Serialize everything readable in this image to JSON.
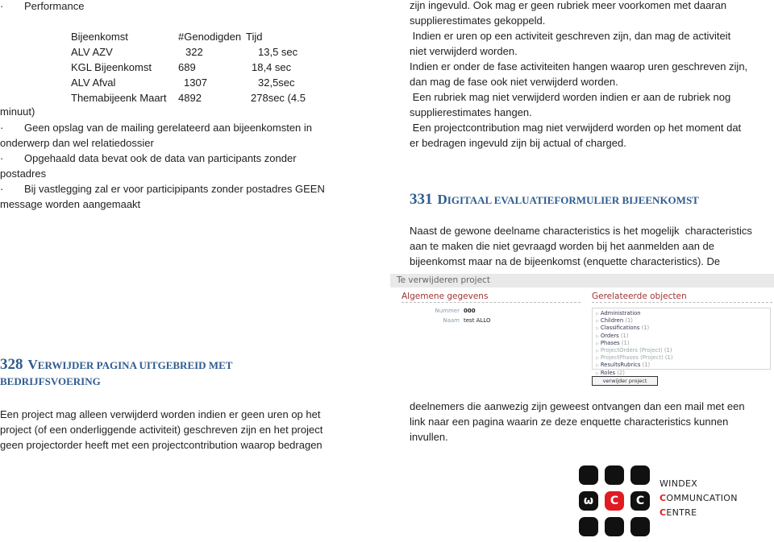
{
  "left_column": {
    "performance_bullet": "·",
    "performance_title": "Performance",
    "table": {
      "headers": [
        "Bijeenkomst",
        "#Genodigden",
        "Tijd"
      ],
      "rows": [
        [
          "ALV AZV",
          "322",
          "13,5 sec"
        ],
        [
          "KGL Bijeenkomst",
          "689",
          "18,4 sec"
        ],
        [
          "ALV Afval",
          "1307",
          "32,5sec"
        ],
        [
          "Themabijeenk Maart",
          "4892",
          "278sec (4.5"
        ]
      ],
      "overflow": "minuut)"
    },
    "bullets": [
      {
        "line1": "Geen opslag van de mailing gerelateerd aan bijeenkomsten in",
        "line2": "onderwerp dan wel relatiedossier"
      },
      {
        "line1": "Opgehaald data bevat ook de data van participants zonder",
        "line2": "postadres"
      },
      {
        "line1": "Bij vastlegging zal er voor participipants zonder postadres GEEN",
        "line2": "message worden aangemaakt"
      }
    ],
    "section328": {
      "number": "328",
      "title_first": "V",
      "title_rest": "ERWIJDER PAGINA UITGEBREID MET",
      "title_line2": "BEDRIJFSVOERING",
      "lines": [
        "Een project mag alleen verwijderd worden indien er geen uren op het",
        "project (of een onderliggende activiteit) geschreven zijn en het project",
        "geen projectorder heeft met een projectcontribution waarop bedragen"
      ]
    }
  },
  "right_column": {
    "lines_top": [
      "zijn ingevuld. Ook mag er geen rubriek meer voorkomen met daaran",
      "supplierestimates gekoppeld.",
      " Indien er uren op een activiteit geschreven zijn, dan mag de activiteit",
      "niet verwijderd worden.",
      "Indien er onder de fase activiteiten hangen waarop uren geschreven zijn,",
      "dan mag de fase ook niet verwijderd worden.",
      " Een rubriek mag niet verwijderd worden indien er aan de rubriek nog",
      "supplierestimates hangen.",
      " Een projectcontribution mag niet verwijderd worden op het moment dat",
      "er bedragen ingevuld zijn bij actual of charged."
    ],
    "section331": {
      "number": "331",
      "title_first": "D",
      "title_rest": "IGITAAL EVALUATIEFORMULIER BIJEENKOMST",
      "lines": [
        "Naast de gewone deelname characteristics is het mogelijk  characteristics",
        "aan te maken die niet gevraagd worden bij het aanmelden aan de",
        "bijeenkomst maar na de bijeenkomst (enquette characteristics). De"
      ]
    },
    "lines_bottom": [
      "deelnemers die aanwezig zijn geweest ontvangen dan een mail met een",
      "link naar een pagina waarin ze deze enquette characteristics kunnen",
      "invullen."
    ]
  },
  "screenshot": {
    "header": "Te verwijderen project",
    "general_title": "Algemene gegevens",
    "fields": [
      {
        "label": "Nummer",
        "value": "000"
      },
      {
        "label": "Naam",
        "value": "test ALLO"
      }
    ],
    "related_title": "Gerelateerde objecten",
    "related_items": [
      {
        "name": "Administration",
        "count": ""
      },
      {
        "name": "Children",
        "count": "(1)"
      },
      {
        "name": "Classifications",
        "count": "(1)"
      },
      {
        "name": "Orders",
        "count": "(1)"
      },
      {
        "name": "Phases",
        "count": "(1)"
      },
      {
        "name": "ProjectOrders (Project)",
        "count": "(1)"
      },
      {
        "name": "ProjectPhases (Project)",
        "count": "(1)"
      },
      {
        "name": "ResultsRubrics",
        "count": "(1)"
      },
      {
        "name": "Roles",
        "count": "(2)"
      }
    ],
    "delete_button": "verwijder project"
  },
  "logo": {
    "line1": "WINDEX",
    "line2_first": "C",
    "line2_rest": "OMMUNCATION",
    "line3_first": "C",
    "line3_rest": "ENTRE",
    "accent_color": "#e21a22"
  }
}
